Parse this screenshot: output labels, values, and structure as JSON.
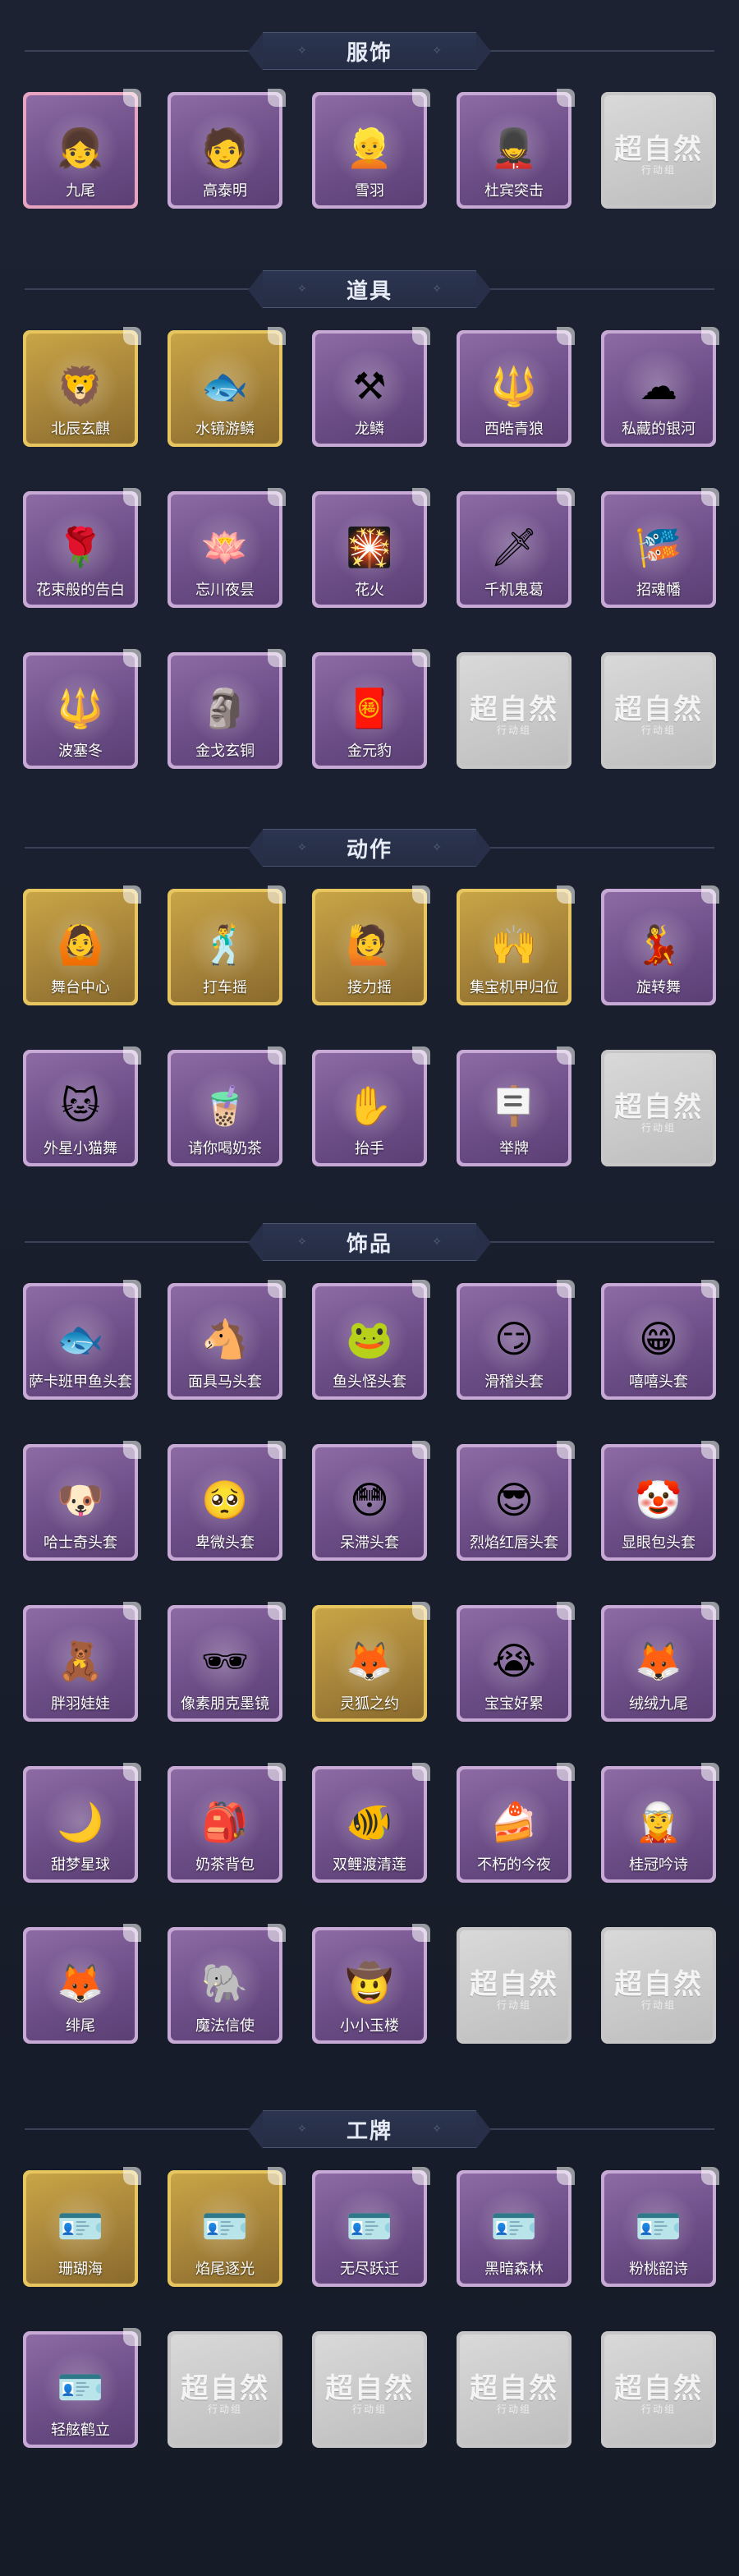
{
  "sections": [
    {
      "title": "服饰",
      "items": [
        {
          "label": "九尾",
          "style": "pink",
          "icon": "fox-girl-icon",
          "glyph": "👧"
        },
        {
          "label": "高泰明",
          "style": "purple",
          "icon": "boy-icon",
          "glyph": "🧑"
        },
        {
          "label": "雪羽",
          "style": "purple",
          "icon": "masked-girl-icon",
          "glyph": "👱"
        },
        {
          "label": "杜宾突击",
          "style": "purple",
          "icon": "soldier-icon",
          "glyph": "💂"
        },
        {
          "label": "",
          "style": "gray",
          "icon": "placeholder-icon",
          "glyph": ""
        }
      ]
    },
    {
      "title": "道具",
      "items": [
        {
          "label": "北辰玄麒",
          "style": "gold",
          "icon": "golden-lion-icon",
          "glyph": "🦁"
        },
        {
          "label": "水镜游鳞",
          "style": "gold",
          "icon": "fishbowl-icon",
          "glyph": "🐟"
        },
        {
          "label": "龙鳞",
          "style": "purple",
          "icon": "shovel-icon",
          "glyph": "⚒"
        },
        {
          "label": "西皓青狼",
          "style": "purple",
          "icon": "staff-icon",
          "glyph": "🔱"
        },
        {
          "label": "私藏的银河",
          "style": "purple",
          "icon": "cloud-icon",
          "glyph": "☁"
        },
        {
          "label": "花束般的告白",
          "style": "purple",
          "icon": "rose-icon",
          "glyph": "🌹"
        },
        {
          "label": "忘川夜昙",
          "style": "purple",
          "icon": "lotus-icon",
          "glyph": "🪷"
        },
        {
          "label": "花火",
          "style": "purple",
          "icon": "sparkler-icon",
          "glyph": "🎇"
        },
        {
          "label": "千机鬼葛",
          "style": "purple",
          "icon": "weapon-icon",
          "glyph": "🗡"
        },
        {
          "label": "招魂幡",
          "style": "purple",
          "icon": "banner-icon",
          "glyph": "🎏"
        },
        {
          "label": "波塞冬",
          "style": "purple",
          "icon": "trident-icon",
          "glyph": "🔱"
        },
        {
          "label": "金戈玄铜",
          "style": "purple",
          "icon": "bronze-statue-icon",
          "glyph": "🗿"
        },
        {
          "label": "金元豹",
          "style": "purple",
          "icon": "fortune-bag-icon",
          "glyph": "🧧"
        },
        {
          "label": "",
          "style": "gray",
          "icon": "placeholder-icon",
          "glyph": ""
        },
        {
          "label": "",
          "style": "gray",
          "icon": "placeholder-icon",
          "glyph": ""
        }
      ]
    },
    {
      "title": "动作",
      "items": [
        {
          "label": "舞台中心",
          "style": "gold",
          "icon": "dance-pose-icon",
          "glyph": "🙆"
        },
        {
          "label": "打车摇",
          "style": "gold",
          "icon": "dance-pose-icon",
          "glyph": "🕺"
        },
        {
          "label": "接力摇",
          "style": "gold",
          "icon": "dance-pose-icon",
          "glyph": "🙋"
        },
        {
          "label": "集宝机甲归位",
          "style": "gold",
          "icon": "dance-pose-icon",
          "glyph": "🙌"
        },
        {
          "label": "旋转舞",
          "style": "purple",
          "icon": "dance-pose-icon",
          "glyph": "💃"
        },
        {
          "label": "外星小猫舞",
          "style": "purple",
          "icon": "dance-pose-icon",
          "glyph": "🐱"
        },
        {
          "label": "请你喝奶茶",
          "style": "purple",
          "icon": "dance-pose-icon",
          "glyph": "🧋"
        },
        {
          "label": "抬手",
          "style": "purple",
          "icon": "hand-icon",
          "glyph": "✋"
        },
        {
          "label": "举牌",
          "style": "purple",
          "icon": "sign-icon",
          "glyph": "🪧"
        },
        {
          "label": "",
          "style": "gray",
          "icon": "placeholder-icon",
          "glyph": ""
        }
      ]
    },
    {
      "title": "饰品",
      "items": [
        {
          "label": "萨卡班甲鱼头套",
          "style": "purple",
          "icon": "fish-head-icon",
          "glyph": "🐟"
        },
        {
          "label": "面具马头套",
          "style": "purple",
          "icon": "horse-head-icon",
          "glyph": "🐴"
        },
        {
          "label": "鱼头怪头套",
          "style": "purple",
          "icon": "fishman-head-icon",
          "glyph": "🐸"
        },
        {
          "label": "滑稽头套",
          "style": "purple",
          "icon": "smirk-face-icon",
          "glyph": "😏"
        },
        {
          "label": "嘻嘻头套",
          "style": "purple",
          "icon": "grin-face-icon",
          "glyph": "😁"
        },
        {
          "label": "哈士奇头套",
          "style": "purple",
          "icon": "dog-head-icon",
          "glyph": "🐶"
        },
        {
          "label": "卑微头套",
          "style": "purple",
          "icon": "pleading-face-icon",
          "glyph": "🥺"
        },
        {
          "label": "呆滞头套",
          "style": "purple",
          "icon": "dazed-face-icon",
          "glyph": "😳"
        },
        {
          "label": "烈焰红唇头套",
          "style": "purple",
          "icon": "pikachu-icon",
          "glyph": "😎"
        },
        {
          "label": "显眼包头套",
          "style": "purple",
          "icon": "bun-head-icon",
          "glyph": "🤡"
        },
        {
          "label": "胖羽娃娃",
          "style": "purple",
          "icon": "doll-icon",
          "glyph": "🧸"
        },
        {
          "label": "像素朋克墨镜",
          "style": "purple",
          "icon": "pixel-glasses-icon",
          "glyph": "🕶"
        },
        {
          "label": "灵狐之约",
          "style": "gold",
          "icon": "fox-mask-icon",
          "glyph": "🦊"
        },
        {
          "label": "宝宝好累",
          "style": "purple",
          "icon": "tired-doll-icon",
          "glyph": "😭"
        },
        {
          "label": "绒绒九尾",
          "style": "purple",
          "icon": "nine-tail-fox-icon",
          "glyph": "🦊"
        },
        {
          "label": "甜梦星球",
          "style": "purple",
          "icon": "moon-icon",
          "glyph": "🌙"
        },
        {
          "label": "奶茶背包",
          "style": "purple",
          "icon": "backpack-icon",
          "glyph": "🎒"
        },
        {
          "label": "双鲤渡清莲",
          "style": "purple",
          "icon": "koi-icon",
          "glyph": "🐠"
        },
        {
          "label": "不朽的今夜",
          "style": "purple",
          "icon": "cake-icon",
          "glyph": "🍰"
        },
        {
          "label": "桂冠吟诗",
          "style": "purple",
          "icon": "poet-icon",
          "glyph": "🧝"
        },
        {
          "label": "绯尾",
          "style": "purple",
          "icon": "fox-spirit-icon",
          "glyph": "🦊"
        },
        {
          "label": "魔法信使",
          "style": "purple",
          "icon": "messenger-icon",
          "glyph": "🐘"
        },
        {
          "label": "小小玉楼",
          "style": "purple",
          "icon": "mini-figure-icon",
          "glyph": "🤠"
        },
        {
          "label": "",
          "style": "gray",
          "icon": "placeholder-icon",
          "glyph": ""
        },
        {
          "label": "",
          "style": "gray",
          "icon": "placeholder-icon",
          "glyph": ""
        }
      ]
    },
    {
      "title": "工牌",
      "items": [
        {
          "label": "珊瑚海",
          "style": "gold",
          "icon": "card-frame-icon",
          "glyph": "🪪"
        },
        {
          "label": "焰尾逐光",
          "style": "gold",
          "icon": "card-frame-icon",
          "glyph": "🪪"
        },
        {
          "label": "无尽跃迁",
          "style": "purple",
          "icon": "card-frame-icon",
          "glyph": "🪪"
        },
        {
          "label": "黑暗森林",
          "style": "purple",
          "icon": "card-frame-icon",
          "glyph": "🪪"
        },
        {
          "label": "粉桃韶诗",
          "style": "purple",
          "icon": "card-frame-icon",
          "glyph": "🪪"
        },
        {
          "label": "轻舷鹤立",
          "style": "purple",
          "icon": "card-frame-icon",
          "glyph": "🪪"
        },
        {
          "label": "",
          "style": "gray",
          "icon": "placeholder-icon",
          "glyph": ""
        },
        {
          "label": "",
          "style": "gray",
          "icon": "placeholder-icon",
          "glyph": ""
        },
        {
          "label": "",
          "style": "gray",
          "icon": "placeholder-icon",
          "glyph": ""
        },
        {
          "label": "",
          "style": "gray",
          "icon": "placeholder-icon",
          "glyph": ""
        }
      ]
    }
  ],
  "placeholder": {
    "title": "超自然",
    "subtitle": "行动组"
  },
  "colors": {
    "background": "#1a1f2e",
    "banner": "#2c3550",
    "gold_border": "#e7c65f",
    "purple_border": "#c6a9d4",
    "pink_border": "#e6a4c0"
  }
}
